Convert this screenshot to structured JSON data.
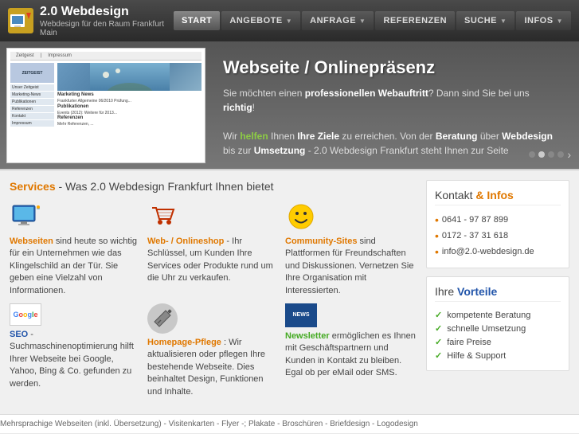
{
  "header": {
    "logo_title": "2.0 Webdesign",
    "logo_subtitle": "Webdesign für den Raum Frankfurt Main",
    "nav": [
      {
        "label": "START",
        "has_arrow": false,
        "active": true
      },
      {
        "label": "ANGEBOTE",
        "has_arrow": true,
        "active": false
      },
      {
        "label": "ANFRAGE",
        "has_arrow": true,
        "active": false
      },
      {
        "label": "REFERENZEN",
        "has_arrow": false,
        "active": false
      },
      {
        "label": "SUCHE",
        "has_arrow": true,
        "active": false
      },
      {
        "label": "INFOS",
        "has_arrow": true,
        "active": false
      }
    ]
  },
  "hero": {
    "title": "Webseite / Onlinepräsenz",
    "desc_line1": "Sie möchten einen ",
    "desc_bold1": "professionellen Webauftritt",
    "desc_line1b": "? Dann sind Sie bei uns ",
    "desc_bold2": "richtig",
    "desc_line2a": "Wir ",
    "desc_green1": "helfen",
    "desc_line2b": " Ihnen ",
    "desc_bold3": "Ihre Ziele",
    "desc_line2c": " zu erreichen. Von der ",
    "desc_bold4": "Beratung",
    "desc_line2d": " über ",
    "desc_bold5": "Webdesign",
    "desc_line2e": " bis zur ",
    "desc_bold6": "Umsetzung",
    "desc_line2f": " - 2.0 Webdesign Frankfurt steht Ihnen zur Seite"
  },
  "services_header": {
    "label1": "Services",
    "label2": " - Was 2.0 Webdesign Frankfurt Ihnen bietet"
  },
  "services_row1": [
    {
      "title": "Webseiten",
      "title_color": "orange",
      "desc": "sind heute so wichtig für ein Unternehmen wie das Klingelschild an der Tür. Sie geben eine Vielzahl von Informationen.",
      "icon_type": "monitor"
    },
    {
      "title": "Web- / Onlineshop",
      "title_color": "orange",
      "desc": " - Ihr Schlüssel, um Kunden Ihre Services oder Produkte rund um die Uhr zu verkaufen.",
      "icon_type": "cart"
    },
    {
      "title": "Community-Sites",
      "title_color": "orange",
      "desc": " sind Plattformen für Freundschaften und Diskussionen. Vernetzen Sie Ihre Organisation mit Interessierten.",
      "icon_type": "smiley"
    }
  ],
  "services_row2": [
    {
      "title": "SEO",
      "title_color": "blue",
      "desc": " - Suchmaschinenoptimierung hilft Ihrer Webseite bei Google, Yahoo, Bing & Co. gefunden zu werden.",
      "icon_type": "seo"
    },
    {
      "title": "Homepage-Pflege",
      "title_color": "orange",
      "desc": ": Wir aktualisieren oder pflegen Ihre bestehende Webseite. Dies beinhaltet Design, Funktionen und Inhalte.",
      "icon_type": "tools"
    },
    {
      "title": "Newsletter",
      "title_color": "green",
      "desc": " ermöglichen es Ihnen mit Geschäftspartnern und Kunden in Kontakt zu bleiben. Egal ob per eMail oder SMS.",
      "icon_type": "news"
    }
  ],
  "sidebar": {
    "kontakt": {
      "title_plain": "Kontakt",
      "title_highlight": " & Infos",
      "items": [
        {
          "text": "0641 - 97 87 899"
        },
        {
          "text": "0172 - 37 31 618"
        },
        {
          "text": "info@2.0-webdesign.de"
        }
      ]
    },
    "vorteile": {
      "title_plain": "Ihre",
      "title_highlight": " Vorteile",
      "items": [
        {
          "text": "kompetente Beratung"
        },
        {
          "text": "schnelle Umsetzung"
        },
        {
          "text": "faire Preise"
        },
        {
          "text": "Hilfe & Support"
        }
      ]
    }
  },
  "bottom_bar": {
    "text": "Mehrsprachige Webseiten (inkl. Übersetzung) - Visitenkarten - Flyer -; Plakate - Broschüren - Briefdesign - Logodesign"
  }
}
